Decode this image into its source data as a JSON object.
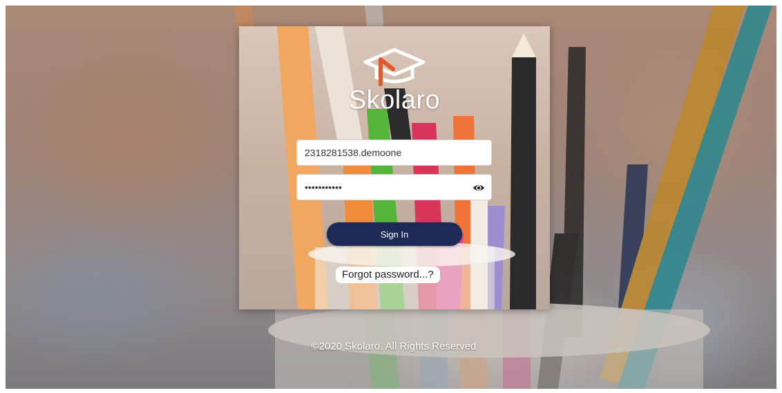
{
  "brand": {
    "name": "Skolaro",
    "logo_icon": "graduation-cap-icon",
    "accent_color": "#e05a2b"
  },
  "login": {
    "username_value": "2318281538.demoone",
    "password_value": "secret12345",
    "password_toggle_icon": "eye-icon",
    "sign_in_label": "Sign In",
    "sign_in_color": "#1c2a55",
    "forgot_label": "Forgot password...?"
  },
  "footer": {
    "copyright": "©2020 Skolaro. All Rights Reserved"
  }
}
